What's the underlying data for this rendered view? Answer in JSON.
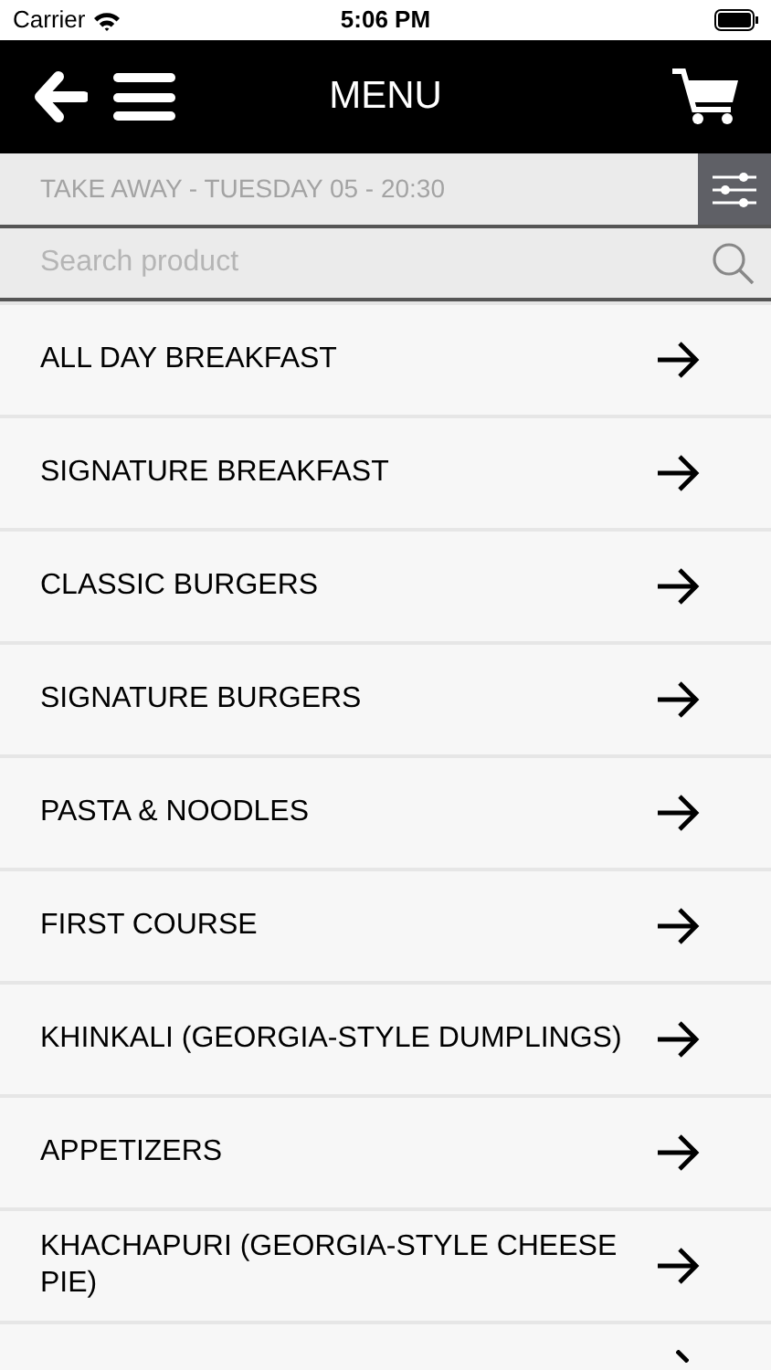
{
  "status_bar": {
    "carrier": "Carrier",
    "time": "5:06 PM"
  },
  "header": {
    "title": "MENU"
  },
  "order_info": {
    "text": "TAKE AWAY - TUESDAY 05 - 20:30"
  },
  "search": {
    "placeholder": "Search product"
  },
  "categories": [
    {
      "label": "ALL DAY BREAKFAST"
    },
    {
      "label": "SIGNATURE BREAKFAST"
    },
    {
      "label": "CLASSIC BURGERS"
    },
    {
      "label": "SIGNATURE BURGERS"
    },
    {
      "label": "PASTA & NOODLES"
    },
    {
      "label": "FIRST COURSE"
    },
    {
      "label": "KHINKALI (GEORGIA-STYLE DUMPLINGS)"
    },
    {
      "label": "APPETIZERS"
    },
    {
      "label": "KHACHAPURI (GEORGIA-STYLE CHEESE PIE)"
    }
  ]
}
